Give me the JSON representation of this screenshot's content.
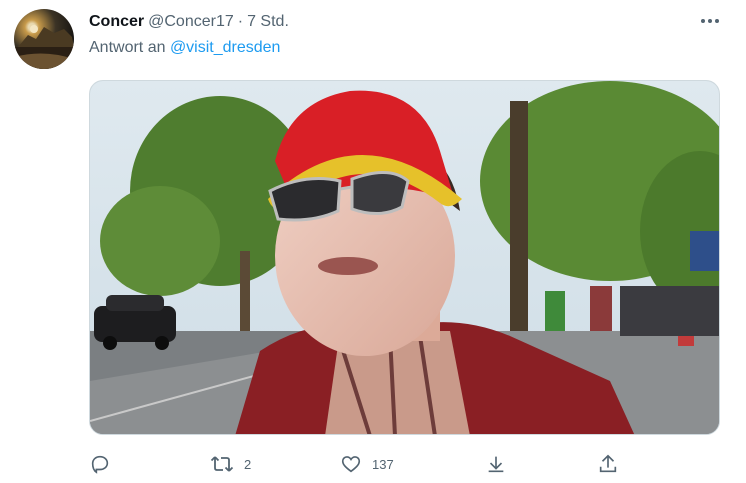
{
  "tweet": {
    "display_name": "Concer",
    "handle": "@Concer17",
    "separator": "·",
    "time": "7 Std.",
    "reply_prefix": "Antwort an",
    "reply_mention": "@visit_dresden",
    "icons": {
      "more": "more-horizontal-icon",
      "reply": "reply-icon",
      "retweet": "retweet-icon",
      "like": "heart-icon",
      "bookmark": "bookmark-icon",
      "share": "share-icon"
    },
    "stats": {
      "replies": "",
      "retweets": "2",
      "likes": "137"
    }
  },
  "colors": {
    "link": "#1d9bf0",
    "secondary_text": "#536471",
    "primary_text": "#0f1419"
  }
}
